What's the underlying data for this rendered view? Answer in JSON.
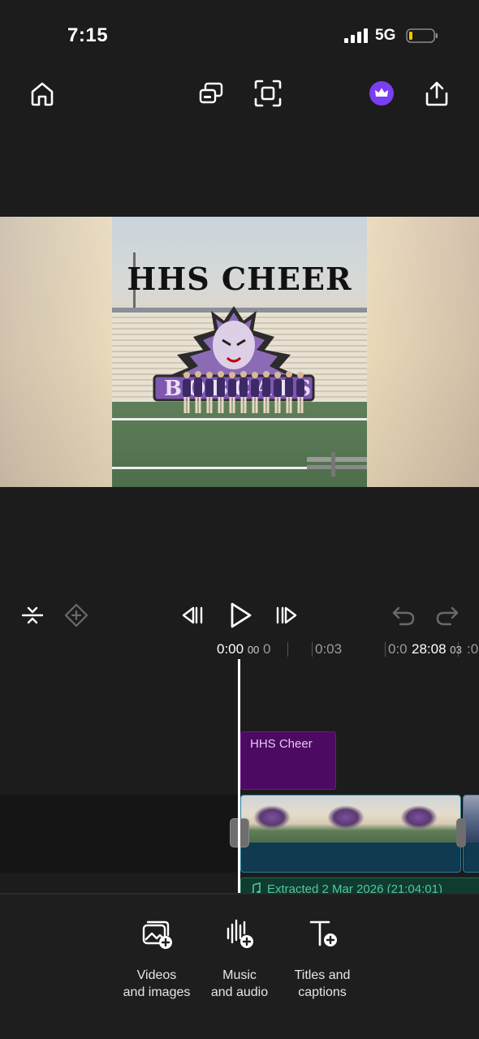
{
  "status_bar": {
    "time": "7:15",
    "network": "5G",
    "signal_icon": "cellular-signal-icon",
    "battery_icon": "battery-low-icon"
  },
  "toolbar": {
    "home_icon": "home-icon",
    "cast_icon": "cast-icon",
    "fullscreen_icon": "fit-screen-icon",
    "premium_icon": "crown-icon",
    "premium_color": "#7b3ff2",
    "share_icon": "share-icon"
  },
  "preview": {
    "overlay_title": "HHS CHEER"
  },
  "playback": {
    "split_icon": "split-icon",
    "keyframe_icon": "keyframe-icon",
    "skip_back_icon": "skip-back-icon",
    "play_icon": "play-icon",
    "skip_forward_icon": "skip-forward-icon",
    "undo_icon": "undo-icon",
    "redo_icon": "redo-icon"
  },
  "ruler": {
    "current_time": "0:00",
    "current_frames": "00",
    "tick_1": "0",
    "tick_2": "0:03",
    "tick_3": "0:0",
    "total_time": "28:08",
    "total_frames": "03",
    "tick_4": ":0"
  },
  "timeline": {
    "title_clip_label": "HHS Cheer",
    "title_clip_color": "#4d0a63",
    "audio_clip_label": "Extracted 2 Mar 2026 (21:04:01)",
    "audio_clip_color": "#53c79b"
  },
  "bottom_tools": [
    {
      "icon": "add-media-icon",
      "label": "Videos\nand images"
    },
    {
      "icon": "add-audio-icon",
      "label": "Music\nand audio"
    },
    {
      "icon": "add-text-icon",
      "label": "Titles and\ncaptions"
    }
  ]
}
